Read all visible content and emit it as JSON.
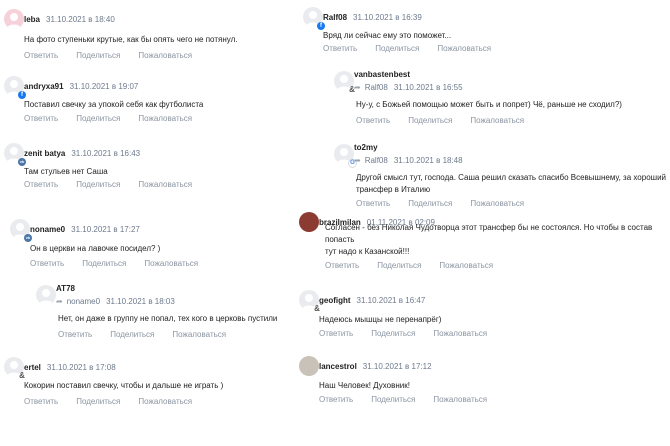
{
  "comments": [
    {
      "author": "leba",
      "date": "31.10.2021 в 18:40",
      "text": "На фото ступеньки крутые, как бы опять чего не потянул.",
      "actions": [
        "Ответить",
        "Поделиться",
        "Пожаловаться"
      ],
      "badge": "",
      "avatar": "pink"
    },
    {
      "author": "andryxa91",
      "date": "31.10.2021 в 19:07",
      "text": "Поставил свечку за упокой себя как футболиста",
      "actions": [
        "Ответить",
        "Поделиться",
        "Пожаловаться"
      ],
      "badge": "f",
      "avatar": "grey"
    },
    {
      "author": "zenit batya",
      "date": "31.10.2021 в 16:43",
      "text": "Там стульев нет Саша",
      "actions": [
        "Ответить",
        "Поделиться",
        "Пожаловаться"
      ],
      "badge": "vk",
      "avatar": "grey"
    },
    {
      "author": "noname0",
      "date": "31.10.2021 в 17:27",
      "text": "Он в церкви на лавочке посидел? )",
      "actions": [
        "Ответить",
        "Поделиться",
        "Пожаловаться"
      ],
      "badge": "vk",
      "avatar": "grey"
    },
    {
      "author": "AT78",
      "reply_to": "noname0",
      "date": "31.10.2021 в 18:03",
      "text": "Нет, он даже в группу не попал, тех кого в церковь пустили",
      "actions": [
        "Ответить",
        "Поделиться",
        "Пожаловаться"
      ],
      "badge": "",
      "avatar": "grey"
    },
    {
      "author": "ertel",
      "date": "31.10.2021 в 17:08",
      "text": "Кокорин поставил свечку, чтобы и дальше не играть )",
      "actions": [
        "Ответить",
        "Поделиться",
        "Пожаловаться"
      ],
      "badge": "&",
      "avatar": "grey"
    },
    {
      "author": "Ralf08",
      "date": "31.10.2021 в 16:39",
      "text": "Вряд ли сейчас ему это поможет...",
      "actions": [
        "Ответить",
        "Поделиться",
        "Пожаловаться"
      ],
      "badge": "f",
      "avatar": "grey"
    },
    {
      "author": "vanbastenbest",
      "reply_to": "Ralf08",
      "date": "31.10.2021 в 16:55",
      "text": "Ну-у, с Божьей помощью может быть и попрет) Чё, раньше не сходил?)",
      "actions": [
        "Ответить",
        "Поделиться",
        "Пожаловаться"
      ],
      "badge": "&",
      "avatar": "grey"
    },
    {
      "author": "to2my",
      "reply_to": "Ralf08",
      "date": "31.10.2021 в 18:48",
      "text_lines": [
        "Другой смысл тут, господа. Саша решил сказать спасибо Всевышнему, за хороший",
        "трансфер в Италию"
      ],
      "actions": [
        "Ответить",
        "Поделиться",
        "Пожаловаться"
      ],
      "badge": "G",
      "avatar": "grey"
    },
    {
      "author": "brazilmilan",
      "date": "01.11.2021 в 02:09",
      "text_lines": [
        "Согласен - без Николая Чудотворца этот трансфер бы не состоялся. Но чтобы в состав попасть",
        "тут надо к Казанской!!!"
      ],
      "actions": [
        "Ответить",
        "Поделиться",
        "Пожаловаться"
      ],
      "badge": "",
      "avatar": "photo1"
    },
    {
      "author": "geofight",
      "date": "31.10.2021 в 16:47",
      "text": "Надеюсь мышцы не перенапрёг)",
      "actions": [
        "Ответить",
        "Поделиться",
        "Пожаловаться"
      ],
      "badge": "&",
      "avatar": "grey"
    },
    {
      "author": "lancestrol",
      "date": "31.10.2021 в 17:12",
      "text": "Наш Человек! Духовник!",
      "actions": [
        "Ответить",
        "Поделиться",
        "Пожаловаться"
      ],
      "badge": "",
      "avatar": "photo2"
    }
  ]
}
